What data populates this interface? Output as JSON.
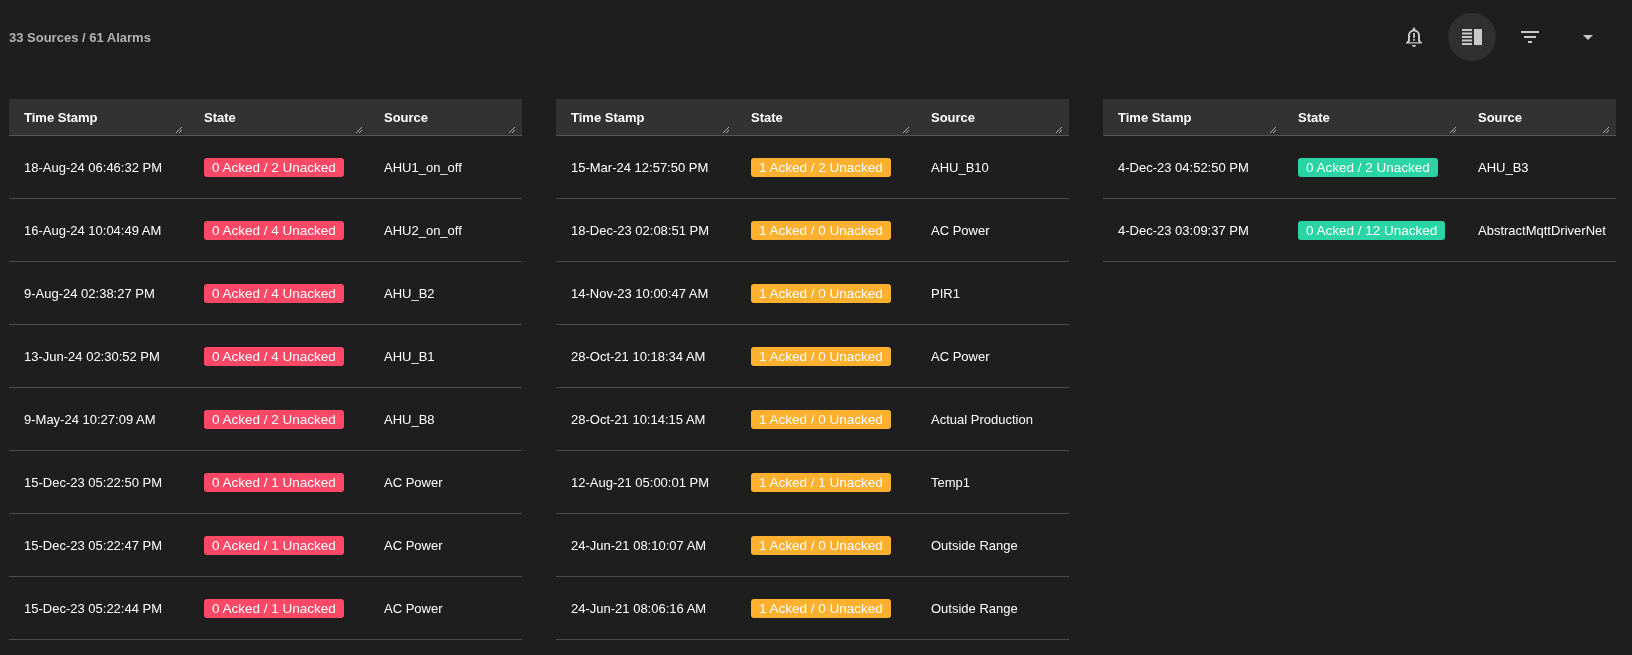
{
  "summary": "33 Sources / 61 Alarms",
  "toolbar": [
    {
      "kind": "alert",
      "active": false
    },
    {
      "kind": "layout",
      "active": true
    },
    {
      "kind": "filter",
      "active": false
    },
    {
      "kind": "menu",
      "active": false
    }
  ],
  "panels": [
    {
      "columns": [
        "Time Stamp",
        "State",
        "Source"
      ],
      "rows": [
        {
          "time": "18-Aug-24 06:46:32 PM",
          "state": "0 Acked / 2 Unacked",
          "color": "#ff4766",
          "source": "AHU1_on_off"
        },
        {
          "time": "16-Aug-24 10:04:49 AM",
          "state": "0 Acked / 4 Unacked",
          "color": "#ff4766",
          "source": "AHU2_on_off"
        },
        {
          "time": "9-Aug-24 02:38:27 PM",
          "state": "0 Acked / 4 Unacked",
          "color": "#ff4766",
          "source": "AHU_B2"
        },
        {
          "time": "13-Jun-24 02:30:52 PM",
          "state": "0 Acked / 4 Unacked",
          "color": "#ff4766",
          "source": "AHU_B1"
        },
        {
          "time": "9-May-24 10:27:09 AM",
          "state": "0 Acked / 2 Unacked",
          "color": "#ff4766",
          "source": "AHU_B8"
        },
        {
          "time": "15-Dec-23 05:22:50 PM",
          "state": "0 Acked / 1 Unacked",
          "color": "#ff4766",
          "source": "AC Power"
        },
        {
          "time": "15-Dec-23 05:22:47 PM",
          "state": "0 Acked / 1 Unacked",
          "color": "#ff4766",
          "source": "AC Power"
        },
        {
          "time": "15-Dec-23 05:22:44 PM",
          "state": "0 Acked / 1 Unacked",
          "color": "#ff4766",
          "source": "AC Power"
        }
      ]
    },
    {
      "columns": [
        "Time Stamp",
        "State",
        "Source"
      ],
      "rows": [
        {
          "time": "15-Mar-24 12:57:50 PM",
          "state": "1 Acked / 2 Unacked",
          "color": "#ffb02e",
          "source": "AHU_B10"
        },
        {
          "time": "18-Dec-23 02:08:51 PM",
          "state": "1 Acked / 0 Unacked",
          "color": "#ffb02e",
          "source": "AC Power"
        },
        {
          "time": "14-Nov-23 10:00:47 AM",
          "state": "1 Acked / 0 Unacked",
          "color": "#ffb02e",
          "source": "PIR1"
        },
        {
          "time": "28-Oct-21 10:18:34 AM",
          "state": "1 Acked / 0 Unacked",
          "color": "#ffb02e",
          "source": "AC Power"
        },
        {
          "time": "28-Oct-21 10:14:15 AM",
          "state": "1 Acked / 0 Unacked",
          "color": "#ffb02e",
          "source": "Actual Production"
        },
        {
          "time": "12-Aug-21 05:00:01 PM",
          "state": "1 Acked / 1 Unacked",
          "color": "#ffb02e",
          "source": "Temp1"
        },
        {
          "time": "24-Jun-21 08:10:07 AM",
          "state": "1 Acked / 0 Unacked",
          "color": "#ffb02e",
          "source": "Outside Range"
        },
        {
          "time": "24-Jun-21 08:06:16 AM",
          "state": "1 Acked / 0 Unacked",
          "color": "#ffb02e",
          "source": "Outside Range"
        }
      ]
    },
    {
      "columns": [
        "Time Stamp",
        "State",
        "Source"
      ],
      "rows": [
        {
          "time": "4-Dec-23 04:52:50 PM",
          "state": "0 Acked / 2 Unacked",
          "color": "#2ad4a4",
          "source": "AHU_B3"
        },
        {
          "time": "4-Dec-23 03:09:37 PM",
          "state": "0 Acked / 12 Unacked",
          "color": "#2ad4a4",
          "source": "AbstractMqttDriverNet"
        }
      ]
    }
  ]
}
